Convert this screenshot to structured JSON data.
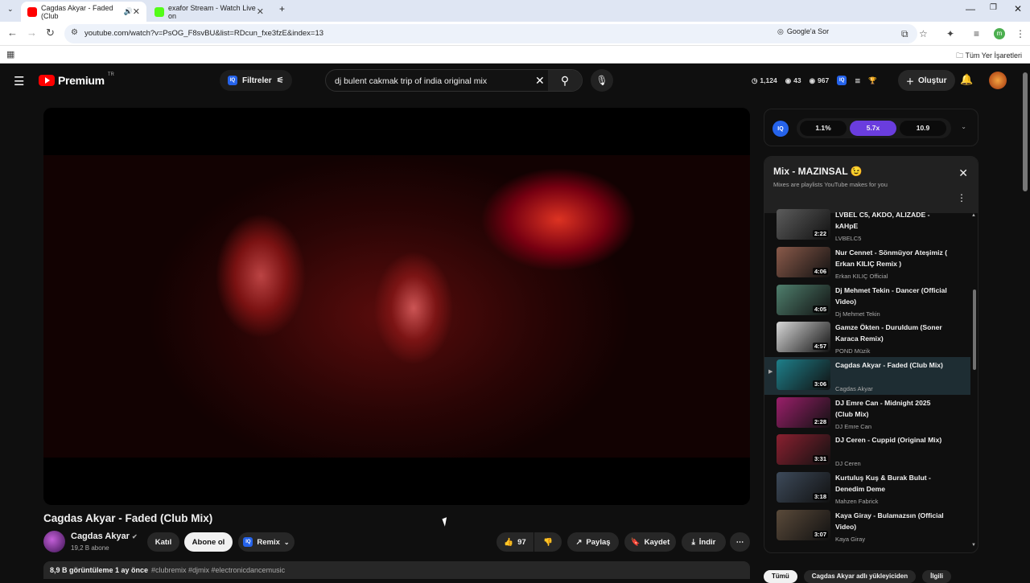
{
  "browser": {
    "tabs": [
      {
        "title": "Cagdas Akyar - Faded (Club",
        "active": true,
        "favicon_color": "#ff0000"
      },
      {
        "title": "exafor Stream - Watch Live on",
        "active": false,
        "favicon_color": "#53fc18"
      }
    ],
    "new_tab": "+",
    "url": "youtube.com/watch?v=PsOG_F8svBU&list=RDcun_fxe3fzE&index=13",
    "google_sor": "Google'a Sor",
    "profile_initial": "m",
    "bookmarks_label": "Tüm Yer İşaretleri"
  },
  "masthead": {
    "logo_text": "Premium",
    "region": "TR",
    "filters_label": "Filtreler",
    "search_query": "dj bulent cakmak trip of india original mix",
    "stats": {
      "a": "1,124",
      "b": "43",
      "c": "967"
    },
    "create_label": "Oluştur"
  },
  "video": {
    "title": "Cagdas Akyar - Faded (Club Mix)",
    "channel": "Cagdas Akyar",
    "subscribers": "19,2 B abone",
    "join_label": "Katıl",
    "subscribe_label": "Abone ol",
    "remix_label": "Remix",
    "likes": "97",
    "share_label": "Paylaş",
    "save_label": "Kaydet",
    "download_label": "İndir",
    "views_time": "8,9 B görüntüleme  1 ay önce",
    "hashtags": "#clubremix #djmix #electronicdancemusic"
  },
  "iq_speed": {
    "options": [
      "1.1%",
      "5.7x",
      "10.9"
    ],
    "selected": "5.7x"
  },
  "mix": {
    "title": "Mix - MAZINSAL 😉",
    "subtitle": "Mixes are playlists YouTube makes for you",
    "items": [
      {
        "title": "LVBEL C5, AKDO, ALIZADE - kAHpE",
        "channel": "LVBELC5",
        "duration": "2:22",
        "color": "#5c5c5c"
      },
      {
        "title": "Nur Cennet - Sönmüyor Ateşimiz ( Erkan KILIÇ Remix )",
        "channel": "Erkan KILIÇ Official",
        "duration": "4:06",
        "color": "#8a5a4a"
      },
      {
        "title": "Dj Mehmet Tekin - Dancer (Official Video)",
        "channel": "Dj Mehmet Tekin",
        "duration": "4:05",
        "color": "#4f7f6d"
      },
      {
        "title": "Gamze Ökten - Duruldum (Soner Karaca Remix)",
        "channel": "POND Müzik",
        "duration": "4:57",
        "color": "#d8d8d8"
      },
      {
        "title": "Cagdas Akyar - Faded (Club Mix)",
        "channel": "Cagdas Akyar",
        "duration": "3:06",
        "color": "#1e7f8a"
      },
      {
        "title": "DJ Emre Can - Midnight 2025 (Club Mix)",
        "channel": "DJ Emre Can",
        "duration": "2:28",
        "color": "#9a1f6a"
      },
      {
        "title": "DJ Ceren - Cuppid (Original Mix)",
        "channel": "DJ Ceren",
        "duration": "3:31",
        "color": "#8a2030"
      },
      {
        "title": "Kurtuluş Kuş & Burak Bulut - Denedim Deme",
        "channel": "Mahzen Fabrick",
        "duration": "3:18",
        "color": "#3d4a5a"
      },
      {
        "title": "Kaya Giray - Bulamazsın (Official Video)",
        "channel": "Kaya Giray",
        "duration": "3:07",
        "color": "#5a4a3a"
      }
    ]
  },
  "chips": [
    "Tümü",
    "Cagdas Akyar adlı yükleyiciden",
    "İlgili"
  ]
}
